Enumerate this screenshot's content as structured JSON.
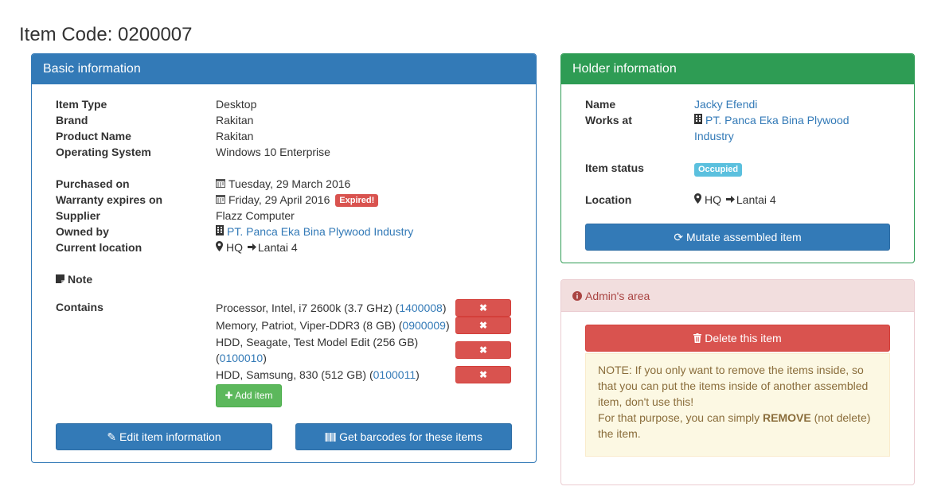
{
  "title": "Item Code: 0200007",
  "basic": {
    "heading": "Basic information",
    "fields": [
      {
        "label": "Item Type",
        "value": "Desktop"
      },
      {
        "label": "Brand",
        "value": "Rakitan"
      },
      {
        "label": "Product Name",
        "value": "Rakitan"
      },
      {
        "label": "Operating System",
        "value": "Windows 10 Enterprise"
      }
    ],
    "purchased_label": "Purchased on",
    "purchased_value": "Tuesday, 29 March 2016",
    "warranty_label": "Warranty expires on",
    "warranty_value": "Friday, 29 April 2016",
    "expired_badge": "Expired!",
    "supplier_label": "Supplier",
    "supplier_value": "Flazz Computer",
    "owned_label": "Owned by",
    "owned_value": "PT. Panca Eka Bina Plywood Industry",
    "location_label": "Current location",
    "location_from": "HQ",
    "location_to": "Lantai 4",
    "note_label": "Note",
    "contains_label": "Contains",
    "contains": [
      {
        "text": "Processor, Intel, i7 2600k (3.7 GHz) (",
        "code": "1400008",
        "close": ")"
      },
      {
        "text": "Memory, Patriot, Viper-DDR3 (8 GB) (",
        "code": "0900009",
        "close": ")"
      },
      {
        "text": "HDD, Seagate, Test Model Edit (256 GB)",
        "text2": "(",
        "code": "0100010",
        "close": ")"
      },
      {
        "text": "HDD, Samsung, 830 (512 GB) (",
        "code": "0100011",
        "close": ")"
      }
    ],
    "remove_label": "Remove",
    "add_item_label": "Add item",
    "edit_button": "Edit item information",
    "barcode_button": "Get barcodes for these items"
  },
  "holder": {
    "heading": "Holder information",
    "name_label": "Name",
    "name_value": "Jacky Efendi",
    "works_label": "Works at",
    "works_value_line1": "PT. Panca Eka Bina Plywood",
    "works_value_line2": "Industry",
    "status_label": "Item status",
    "status_value": "Occupied",
    "location_label": "Location",
    "location_from": "HQ",
    "location_to": "Lantai 4",
    "mutate_button": "Mutate assembled item"
  },
  "admin": {
    "heading": "Admin's area",
    "delete_button": "Delete this item",
    "note_line1": "NOTE: If you only want to remove the items inside, so that you can put the items inside of another assembled item, don't use this!",
    "note_line2_pre": "For that purpose, you can simply ",
    "note_line2_bold": "REMOVE",
    "note_line2_post": " (not delete) the item."
  },
  "colors": {
    "primary": "#337ab7",
    "success": "#2e9c54",
    "danger": "#d9534f",
    "add": "#5cb85c",
    "info": "#5bc0de",
    "warning_bg": "#fcf8e3"
  },
  "icons": {
    "calendar": "calendar-icon",
    "building": "building-icon",
    "map_marker": "map-marker-icon",
    "arrow_right": "arrow-right-icon",
    "sticky_note": "sticky-note-icon",
    "times": "times-icon",
    "plus": "plus-icon",
    "edit": "edit-icon",
    "barcode": "barcode-icon",
    "refresh": "refresh-icon",
    "trash": "trash-icon",
    "info": "info-circle-icon"
  }
}
